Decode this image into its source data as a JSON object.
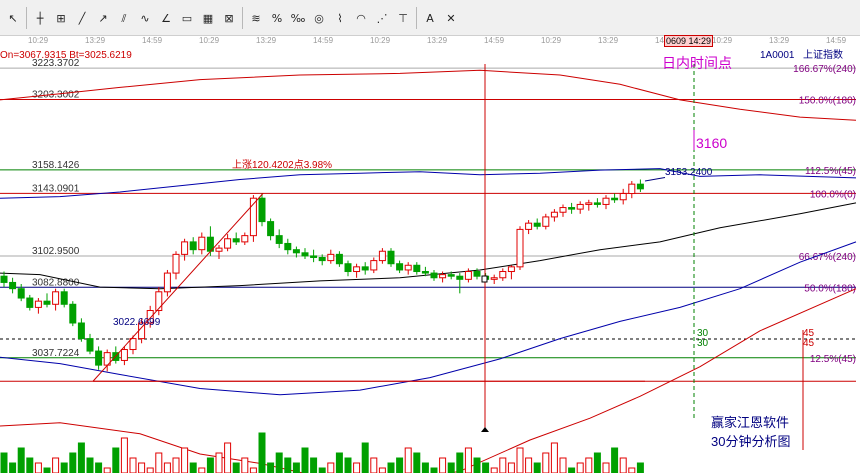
{
  "toolbar": {
    "tools": [
      {
        "name": "pointer-tool",
        "glyph": "↖"
      },
      {
        "name": "crosshair-tool",
        "glyph": "┼"
      },
      {
        "name": "fib-tool",
        "glyph": "⊞"
      },
      {
        "name": "line-tool",
        "glyph": "╱"
      },
      {
        "name": "ray-tool",
        "glyph": "↗"
      },
      {
        "name": "channel-tool",
        "glyph": "⫽"
      },
      {
        "name": "wave-tool",
        "glyph": "∿"
      },
      {
        "name": "angle-tool",
        "glyph": "∠"
      },
      {
        "name": "rect-tool",
        "glyph": "▭"
      },
      {
        "name": "grid-tool",
        "glyph": "▦"
      },
      {
        "name": "gann-tool",
        "glyph": "⊠"
      },
      {
        "name": "fib-fan-tool",
        "glyph": "≋"
      },
      {
        "name": "percent-tool",
        "glyph": "%"
      },
      {
        "name": "ratio-tool",
        "glyph": "‰"
      },
      {
        "name": "circle-tool",
        "glyph": "◎"
      },
      {
        "name": "cycle-tool",
        "glyph": "⌇"
      },
      {
        "name": "arc-tool",
        "glyph": "◠"
      },
      {
        "name": "speed-tool",
        "glyph": "⋰"
      },
      {
        "name": "time-tool",
        "glyph": "⊤"
      },
      {
        "name": "text-tool",
        "glyph": "A"
      },
      {
        "name": "delete-tool",
        "glyph": "✕"
      }
    ]
  },
  "time_axis": [
    "10:29",
    "13:29",
    "14:59",
    "10:29",
    "13:29",
    "14:59",
    "10:29",
    "13:29",
    "14:59",
    "10:29",
    "13:29",
    "14:59",
    "10:29",
    "13:29",
    "14:59"
  ],
  "cursor_time": "0609 14:29",
  "header": {
    "left_info": "On=3067.9315  Bt=3025.6219",
    "index_code": "1A0001",
    "index_name": "上证指数"
  },
  "annotations": {
    "intraday_point": "日内时间点",
    "target_level": "3160",
    "rise_label": "上涨120.4202点3.98%",
    "low_label": "3022.6699",
    "cursor_price": "3153.2400",
    "software": "赢家江恩软件",
    "analysis": "30分钟分析图",
    "gann_30a": "30",
    "gann_30b": "30",
    "gann_45a": "45",
    "gann_45b": "45"
  },
  "colors": {
    "up": "#e00000",
    "down": "#00a000",
    "ma_blue": "#0000aa",
    "ma_red": "#cc0000",
    "ma_dark": "#000000",
    "magenta": "#cc00cc",
    "darkgreen": "#008000"
  },
  "chart_data": {
    "type": "candlestick",
    "title": "",
    "ylim": [
      2985,
      3235
    ],
    "price_levels": [
      {
        "price": 3223.3702,
        "label": "3223.3702",
        "right_label": "166.67%(240)",
        "color": "#aaaaaa"
      },
      {
        "price": 3203.3002,
        "label": "3203.3002",
        "right_label": "150.0%(180)",
        "color": "#cc0000"
      },
      {
        "price": 3158.1426,
        "label": "3158.1426",
        "right_label": "112.5%(45)",
        "color": "#008000"
      },
      {
        "price": 3143.0901,
        "label": "3143.0901",
        "right_label": "100.0%(0)",
        "color": "#cc0000"
      },
      {
        "price": 3102.95,
        "label": "3102.9500",
        "right_label": "66.67%(240)",
        "color": "#aaaaaa"
      },
      {
        "price": 3082.88,
        "label": "3082.8800",
        "right_label": "50.0%(180)",
        "color": "#000080"
      },
      {
        "price": 3037.7224,
        "label": "3037.7224",
        "right_label": "12.5%(45)",
        "color": "#008000"
      },
      {
        "price": 3022.6699,
        "label": "",
        "right_label": "",
        "color": "#cc0000"
      }
    ],
    "candles": [
      [
        3090,
        3093,
        3083,
        3086
      ],
      [
        3086,
        3089,
        3079,
        3082
      ],
      [
        3082,
        3085,
        3074,
        3076
      ],
      [
        3076,
        3078,
        3068,
        3070
      ],
      [
        3070,
        3076,
        3066,
        3074
      ],
      [
        3074,
        3079,
        3070,
        3072
      ],
      [
        3072,
        3082,
        3068,
        3080
      ],
      [
        3080,
        3082,
        3070,
        3072
      ],
      [
        3072,
        3074,
        3058,
        3060
      ],
      [
        3060,
        3063,
        3048,
        3050
      ],
      [
        3050,
        3053,
        3040,
        3042
      ],
      [
        3042,
        3045,
        3030,
        3033
      ],
      [
        3033,
        3043,
        3029,
        3041
      ],
      [
        3041,
        3045,
        3034,
        3036
      ],
      [
        3036,
        3045,
        3033,
        3043
      ],
      [
        3043,
        3052,
        3040,
        3050
      ],
      [
        3050,
        3063,
        3047,
        3060
      ],
      [
        3060,
        3071,
        3057,
        3068
      ],
      [
        3068,
        3083,
        3065,
        3080
      ],
      [
        3080,
        3094,
        3077,
        3092
      ],
      [
        3092,
        3106,
        3088,
        3104
      ],
      [
        3104,
        3114,
        3100,
        3112
      ],
      [
        3112,
        3115,
        3104,
        3107
      ],
      [
        3107,
        3118,
        3104,
        3115
      ],
      [
        3115,
        3122,
        3103,
        3106
      ],
      [
        3106,
        3110,
        3101,
        3108
      ],
      [
        3108,
        3117,
        3106,
        3114
      ],
      [
        3114,
        3118,
        3110,
        3112
      ],
      [
        3112,
        3118,
        3110,
        3116
      ],
      [
        3116,
        3142,
        3112,
        3140
      ],
      [
        3140,
        3143,
        3122,
        3125
      ],
      [
        3125,
        3127,
        3113,
        3116
      ],
      [
        3116,
        3120,
        3108,
        3111
      ],
      [
        3111,
        3114,
        3104,
        3107
      ],
      [
        3107,
        3109,
        3102,
        3105
      ],
      [
        3105,
        3108,
        3101,
        3103
      ],
      [
        3103,
        3107,
        3099,
        3102
      ],
      [
        3102,
        3104,
        3097,
        3100
      ],
      [
        3100,
        3107,
        3098,
        3104
      ],
      [
        3104,
        3106,
        3096,
        3098
      ],
      [
        3098,
        3100,
        3090,
        3093
      ],
      [
        3093,
        3098,
        3089,
        3096
      ],
      [
        3096,
        3099,
        3091,
        3094
      ],
      [
        3094,
        3102,
        3092,
        3100
      ],
      [
        3100,
        3108,
        3098,
        3106
      ],
      [
        3106,
        3108,
        3096,
        3098
      ],
      [
        3098,
        3100,
        3092,
        3094
      ],
      [
        3094,
        3099,
        3091,
        3097
      ],
      [
        3097,
        3099,
        3091,
        3093
      ],
      [
        3093,
        3096,
        3090,
        3092
      ],
      [
        3092,
        3094,
        3087,
        3089
      ],
      [
        3089,
        3093,
        3086,
        3091
      ],
      [
        3091,
        3093,
        3088,
        3090
      ],
      [
        3090,
        3092,
        3079,
        3088
      ],
      [
        3088,
        3095,
        3086,
        3093
      ],
      [
        3093,
        3095,
        3088,
        3090
      ],
      [
        3090,
        3092,
        3086,
        3088
      ],
      [
        3088,
        3091,
        3085,
        3089
      ],
      [
        3089,
        3095,
        3087,
        3093
      ],
      [
        3093,
        3097,
        3088,
        3096
      ],
      [
        3096,
        3122,
        3094,
        3120
      ],
      [
        3120,
        3126,
        3117,
        3124
      ],
      [
        3124,
        3127,
        3120,
        3122
      ],
      [
        3122,
        3130,
        3120,
        3128
      ],
      [
        3128,
        3133,
        3125,
        3131
      ],
      [
        3131,
        3136,
        3128,
        3134
      ],
      [
        3134,
        3137,
        3130,
        3133
      ],
      [
        3133,
        3138,
        3130,
        3136
      ],
      [
        3136,
        3139,
        3132,
        3137
      ],
      [
        3137,
        3140,
        3134,
        3136
      ],
      [
        3136,
        3142,
        3133,
        3140
      ],
      [
        3140,
        3143,
        3137,
        3139
      ],
      [
        3139,
        3146,
        3136,
        3143
      ],
      [
        3143,
        3151,
        3140,
        3149
      ],
      [
        3149,
        3152,
        3144,
        3146
      ]
    ],
    "moving_averages": [
      {
        "name": "MA-blue",
        "color": "#0000aa",
        "values": [
          [
            0,
            3140
          ],
          [
            60,
            3141
          ],
          [
            120,
            3144
          ],
          [
            180,
            3148
          ],
          [
            240,
            3152
          ],
          [
            300,
            3155
          ],
          [
            360,
            3156
          ],
          [
            420,
            3157
          ],
          [
            480,
            3155
          ],
          [
            540,
            3156
          ],
          [
            600,
            3158
          ],
          [
            660,
            3159
          ],
          [
            700,
            3154
          ],
          [
            760,
            3155
          ],
          [
            856,
            3153
          ]
        ]
      },
      {
        "name": "MA-black",
        "color": "#000000",
        "values": [
          [
            0,
            3092
          ],
          [
            40,
            3091
          ],
          [
            100,
            3083
          ],
          [
            160,
            3082
          ],
          [
            240,
            3084
          ],
          [
            320,
            3087
          ],
          [
            400,
            3089
          ],
          [
            480,
            3094
          ],
          [
            540,
            3100
          ],
          [
            600,
            3107
          ],
          [
            660,
            3112
          ],
          [
            720,
            3121
          ],
          [
            800,
            3130
          ],
          [
            856,
            3137
          ]
        ]
      },
      {
        "name": "MA-blue-low",
        "color": "#0000aa",
        "values": [
          [
            0,
            3038
          ],
          [
            60,
            3034
          ],
          [
            120,
            3027
          ],
          [
            200,
            3018
          ],
          [
            280,
            3014
          ],
          [
            360,
            3017
          ],
          [
            430,
            3025
          ],
          [
            500,
            3037
          ],
          [
            560,
            3050
          ],
          [
            620,
            3061
          ],
          [
            680,
            3070
          ],
          [
            740,
            3082
          ],
          [
            800,
            3099
          ],
          [
            856,
            3112
          ]
        ]
      },
      {
        "name": "MA-red-upper",
        "color": "#cc0000",
        "values": [
          [
            0,
            3203
          ],
          [
            60,
            3207
          ],
          [
            120,
            3211
          ],
          [
            200,
            3216
          ],
          [
            300,
            3219
          ],
          [
            400,
            3220
          ],
          [
            480,
            3222
          ],
          [
            560,
            3219
          ],
          [
            620,
            3213
          ],
          [
            680,
            3203
          ],
          [
            740,
            3197
          ],
          [
            800,
            3192
          ],
          [
            856,
            3190
          ]
        ]
      },
      {
        "name": "MA-red-lower",
        "color": "#cc0000",
        "values": [
          [
            0,
            2994
          ],
          [
            60,
            2996
          ],
          [
            140,
            2989
          ],
          [
            200,
            2976
          ],
          [
            260,
            2970
          ],
          [
            330,
            2960
          ],
          [
            400,
            2958
          ],
          [
            460,
            2965
          ],
          [
            530,
            2985
          ],
          [
            590,
            2999
          ],
          [
            640,
            3013
          ],
          [
            700,
            3032
          ],
          [
            760,
            3055
          ],
          [
            856,
            3082
          ]
        ]
      }
    ],
    "volume": [
      4,
      2,
      5,
      3,
      2,
      1,
      3,
      2,
      4,
      6,
      3,
      2,
      1,
      5,
      7,
      3,
      2,
      1,
      4,
      2,
      3,
      5,
      2,
      1,
      3,
      4,
      6,
      2,
      3,
      1,
      8,
      2,
      4,
      3,
      2,
      5,
      3,
      1,
      2,
      4,
      3,
      2,
      6,
      3,
      1,
      2,
      3,
      5,
      4,
      2,
      1,
      3,
      2,
      4,
      5,
      3,
      2,
      1,
      3,
      2,
      5,
      3,
      2,
      4,
      6,
      3,
      1,
      2,
      3,
      4,
      2,
      5,
      3,
      1,
      2
    ]
  }
}
